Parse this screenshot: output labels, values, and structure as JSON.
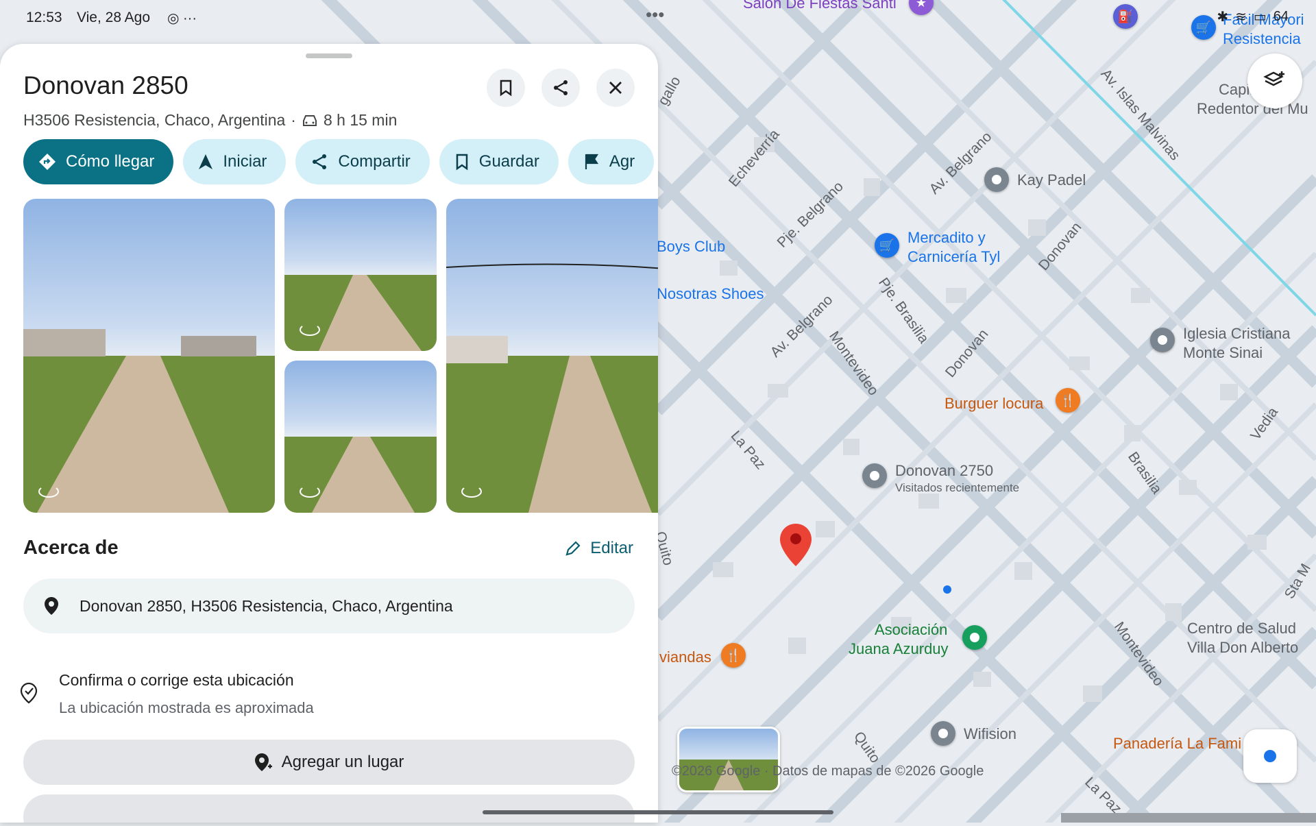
{
  "status_bar": {
    "time": "12:53",
    "date": "Vie, 28 Ago",
    "battery": "64"
  },
  "place": {
    "title": "Donovan 2850",
    "subtitle_address": "H3506 Resistencia, Chaco, Argentina",
    "separator": "·",
    "travel_time": "8 h 15 min"
  },
  "actions": {
    "directions": "Cómo llegar",
    "start": "Iniciar",
    "share": "Compartir",
    "save": "Guardar",
    "add_label_partial": "Agr"
  },
  "about": {
    "title": "Acerca de",
    "edit": "Editar",
    "full_address": "Donovan 2850, H3506 Resistencia, Chaco, Argentina",
    "confirm_title": "Confirma o corrige esta ubicación",
    "confirm_sub": "La ubicación mostrada es aproximada",
    "add_place": "Agregar un lugar"
  },
  "map": {
    "copyright": "©2026 Google · Datos de mapas de ©2026 Google",
    "streets": [
      "Echeverría",
      "Pje. Belgrano",
      "Av. Belgrano",
      "Av. Belgrano",
      "Pje. Brasilia",
      "Montevideo",
      "Donovan",
      "Donovan",
      "La Paz",
      "Brasilia",
      "Vedia",
      "Av. Islas Malvinas",
      "Montevideo",
      "Quito",
      "La Paz",
      "Quito",
      "Sta M",
      "gallo"
    ],
    "pois": {
      "salon": "Salón De Fiestas Santi",
      "kay_padel": "Kay Padel",
      "mercadito": "Mercadito y",
      "mercadito2": "Carnicería Tyl",
      "boys_club": "Boys Club",
      "nosotras": "Nosotras Shoes",
      "iglesia1": "Iglesia Cristiana",
      "iglesia2": "Monte Sinai",
      "burguer": "Burguer locura",
      "donovan2750": "Donovan 2750",
      "visitados": "Visitados recientemente",
      "asociacion1": "Asociación",
      "asociacion2": "Juana Azurduy",
      "viandas": "viandas",
      "centro1": "Centro de Salud",
      "centro2": "Villa Don Alberto",
      "wifision": "Wifision",
      "panaderia": "Panadería La Fami",
      "facil1": "Facil Mayori",
      "facil2": "Resistencia",
      "capilla1": "Capilla Cri",
      "capilla2": "Redentor del Mu"
    }
  },
  "colors": {
    "primary_chip": "#0b7285",
    "chip": "#d3f0f9",
    "map_bg": "#e9edf1",
    "road": "#c9d3dd",
    "pin": "#ea4335"
  }
}
